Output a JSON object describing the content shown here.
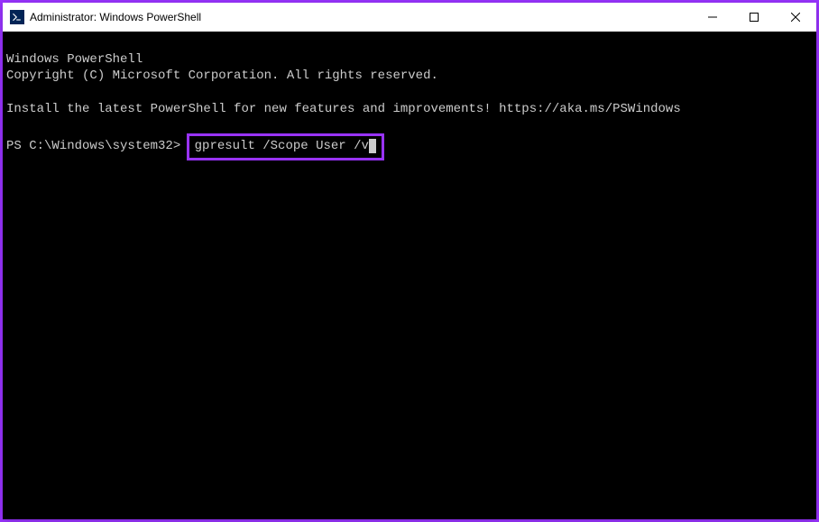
{
  "titlebar": {
    "title": "Administrator: Windows PowerShell"
  },
  "terminal": {
    "line1": "Windows PowerShell",
    "line2": "Copyright (C) Microsoft Corporation. All rights reserved.",
    "line3": "",
    "line4": "Install the latest PowerShell for new features and improvements! https://aka.ms/PSWindows",
    "line5": "",
    "prompt": "PS C:\\Windows\\system32> ",
    "command": "gpresult /Scope User /v"
  }
}
